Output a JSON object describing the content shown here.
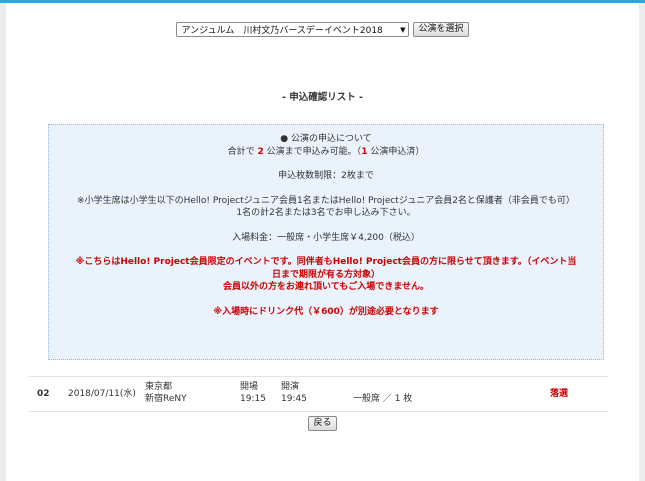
{
  "performance_select": {
    "selected": "アンジュルム　川村文乃バースデーイベント2018",
    "button_label": "公演を選択"
  },
  "list_title": "- 申込確認リスト -",
  "notice": {
    "heading": "●  公演の申込について",
    "limit_prefix": "合計で",
    "limit_count": "2",
    "limit_middle": "公演まで申込み可能。（",
    "applied_count": "1",
    "applied_suffix": "公演申込済）",
    "ticket_limit": "申込枚数制限：2枚まで",
    "child_line1": "※小学生席は小学生以下のHello! Projectジュニア会員1名またはHello! Projectジュニア会員2名と保護者（非会員でも可）",
    "child_line2": "1名の計2名または3名でお申し込み下さい。",
    "price": "入場料金：一般席・小学生席￥4,200（税込）",
    "member_line1": "※こちらはHello! Project会員限定のイベントです。同伴者もHello! Project会員の方に限らせて頂きます。（イベント当",
    "member_line2": "日まで期限が有る方対象）",
    "member_line3": "会員以外の方をお連れ頂いてもご入場できません。",
    "drink": "※入場時にドリンク代（￥600）が別途必要となります"
  },
  "result_row": {
    "number": "02",
    "date": "2018/07/11(水)",
    "venue_pref": "東京都",
    "venue_name": "新宿ReNY",
    "open_label": "開場",
    "open_time": "19:15",
    "start_label": "開演",
    "start_time": "19:45",
    "seat": "一般席 ／ 1 枚",
    "result": "落選"
  },
  "back_label": "戻る"
}
